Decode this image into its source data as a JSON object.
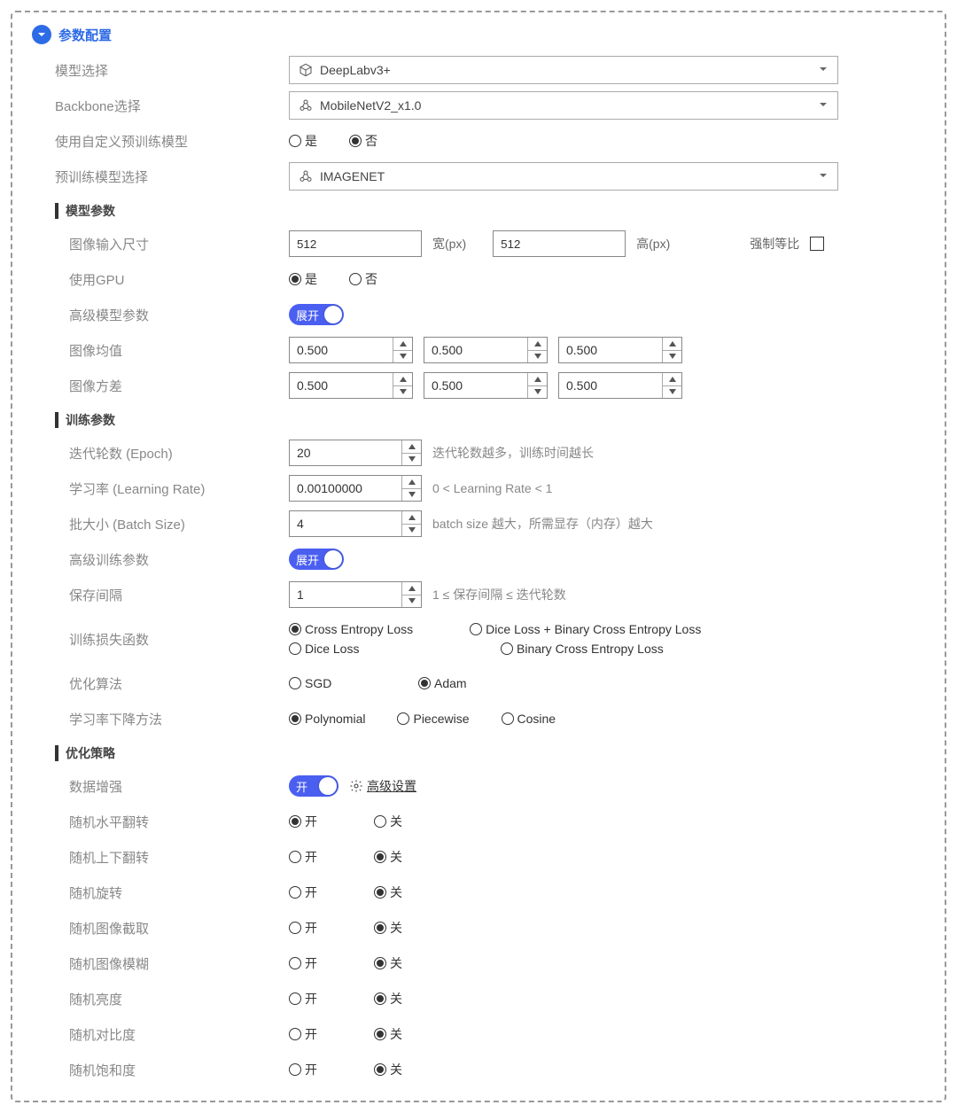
{
  "header": {
    "title": "参数配置"
  },
  "labels": {
    "model_select": "模型选择",
    "backbone_select": "Backbone选择",
    "use_custom_pretrain": "使用自定义预训练模型",
    "pretrain_select": "预训练模型选择",
    "section_model_params": "模型参数",
    "image_input_size": "图像输入尺寸",
    "use_gpu": "使用GPU",
    "adv_model_params": "高级模型参数",
    "image_mean": "图像均值",
    "image_variance": "图像方差",
    "section_train_params": "训练参数",
    "epoch": "迭代轮数 (Epoch)",
    "lr": "学习率 (Learning Rate)",
    "batch": "批大小 (Batch Size)",
    "adv_train_params": "高级训练参数",
    "save_interval": "保存间隔",
    "loss_fn": "训练损失函数",
    "optimizer": "优化算法",
    "lr_decay": "学习率下降方法",
    "section_opt_strategy": "优化策略",
    "data_aug": "数据增强",
    "adv_setting": "高级设置",
    "rand_hflip": "随机水平翻转",
    "rand_vflip": "随机上下翻转",
    "rand_rotate": "随机旋转",
    "rand_crop": "随机图像截取",
    "rand_blur": "随机图像模糊",
    "rand_brightness": "随机亮度",
    "rand_contrast": "随机对比度",
    "rand_saturation": "随机饱和度",
    "width_unit": "宽(px)",
    "height_unit": "高(px)",
    "force_ratio": "强制等比"
  },
  "values": {
    "model": "DeepLabv3+",
    "backbone": "MobileNetV2_x1.0",
    "pretrain": "IMAGENET",
    "width": "512",
    "height": "512",
    "mean": [
      "0.500",
      "0.500",
      "0.500"
    ],
    "variance": [
      "0.500",
      "0.500",
      "0.500"
    ],
    "epoch": "20",
    "lr": "0.00100000",
    "batch": "4",
    "save_interval": "1"
  },
  "options": {
    "yes": "是",
    "no": "否",
    "on": "开",
    "off": "关",
    "expand": "展开",
    "loss": {
      "cross_entropy": "Cross Entropy Loss",
      "dice_bce": "Dice Loss + Binary Cross Entropy Loss",
      "dice": "Dice Loss",
      "bce": "Binary Cross Entropy Loss"
    },
    "opt": {
      "sgd": "SGD",
      "adam": "Adam"
    },
    "decay": {
      "poly": "Polynomial",
      "piece": "Piecewise",
      "cos": "Cosine"
    }
  },
  "hints": {
    "epoch": "迭代轮数越多，训练时间越长",
    "lr": "0 < Learning Rate < 1",
    "batch": "batch size 越大，所需显存（内存）越大",
    "save": "1 ≤ 保存间隔 ≤ 迭代轮数"
  },
  "state": {
    "use_custom_pretrain": "no",
    "use_gpu": "yes",
    "loss": "cross_entropy",
    "optimizer": "adam",
    "decay": "poly",
    "hflip": "on",
    "vflip": "off",
    "rotate": "off",
    "crop": "off",
    "blur": "off",
    "brightness": "off",
    "contrast": "off",
    "saturation": "off"
  }
}
